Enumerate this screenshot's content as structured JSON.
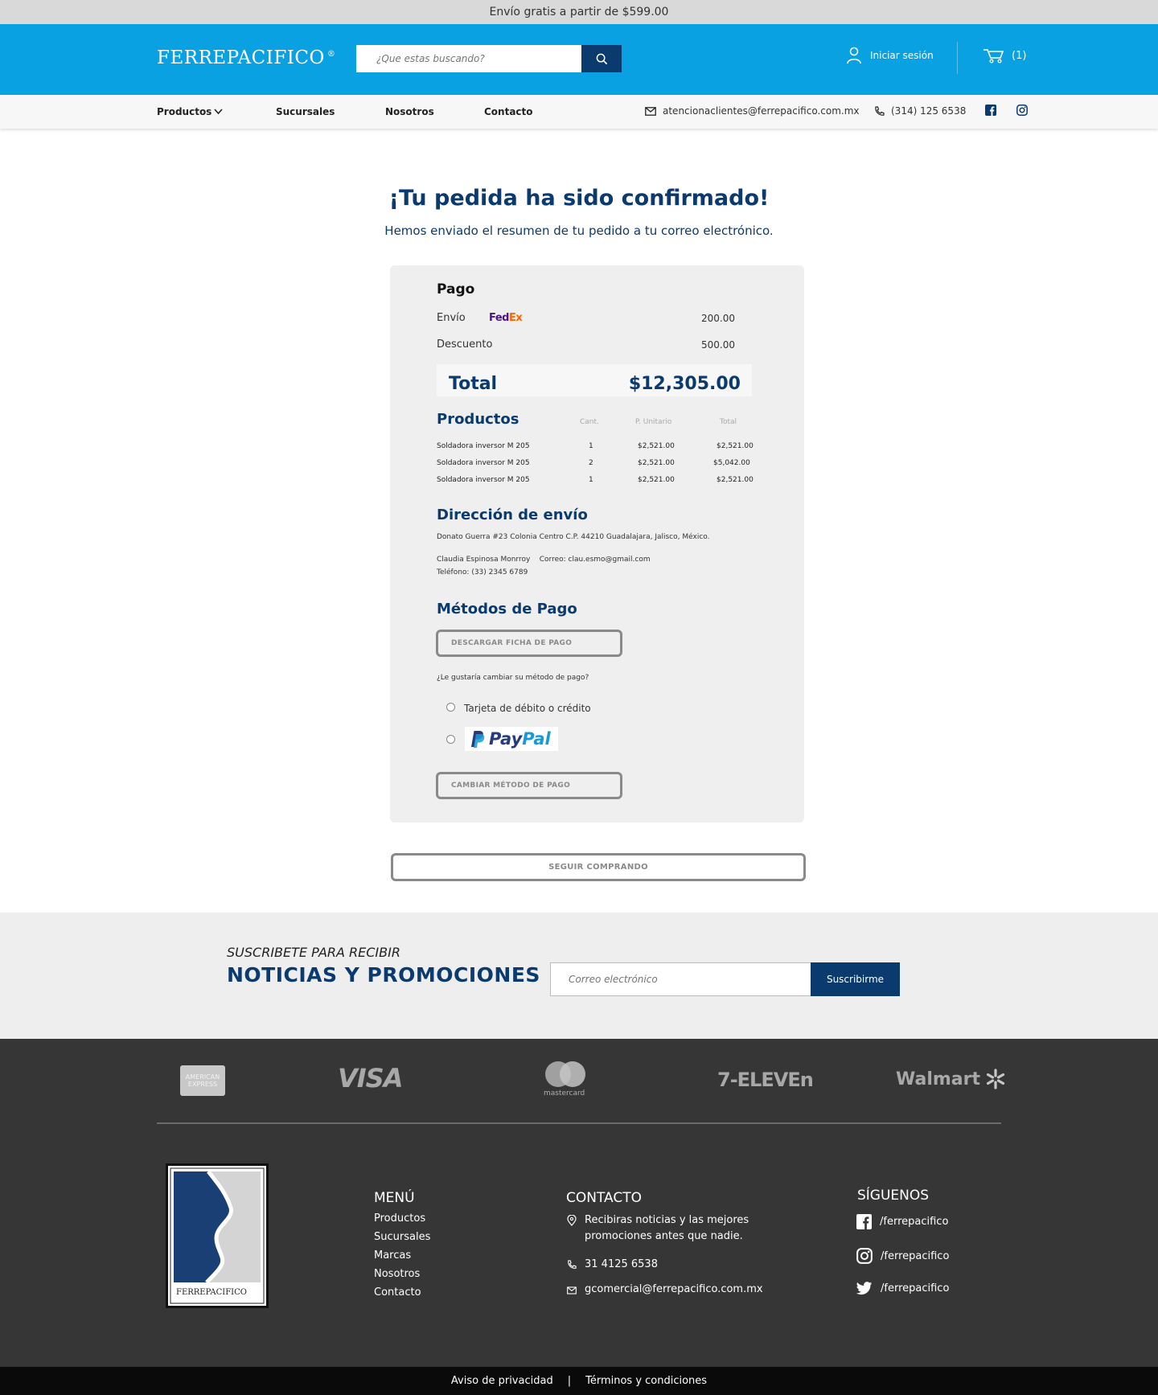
{
  "promo": {
    "text": "Envío gratis a partir de $599.00"
  },
  "header": {
    "logo": "FERREPACIFICO",
    "logo_mark": "®",
    "search_placeholder": "¿Que estas buscando?",
    "login": "Iniciar sesión",
    "cart_count": "(1)"
  },
  "nav": {
    "items": [
      "Productos",
      "Sucursales",
      "Nosotros",
      "Contacto"
    ],
    "email": "atencionaclientes@ferrepacifico.com.mx",
    "phone": "(314) 125 6538"
  },
  "confirmation": {
    "title": "¡Tu pedida ha sido confirmado!",
    "subtitle": "Hemos enviado el resumen de tu pedido a tu correo electrónico."
  },
  "pago": {
    "heading": "Pago",
    "envio_label": "Envío",
    "carrier_a": "Fed",
    "carrier_b": "Ex",
    "envio_value": "200.00",
    "descuento_label": "Descuento",
    "descuento_value": "500.00",
    "total_label": "Total",
    "total_value": "$12,305.00"
  },
  "productos": {
    "heading": "Productos",
    "columns": [
      "Cant.",
      "P. Unitario",
      "Total"
    ],
    "rows": [
      {
        "name": "Soldadora inversor M 205",
        "qty": "1",
        "unit": "$2,521.00",
        "total": "$2,521.00"
      },
      {
        "name": "Soldadora inversor M 205",
        "qty": "2",
        "unit": "$2,521.00",
        "total": "$5,042.00"
      },
      {
        "name": "Soldadora inversor M 205",
        "qty": "1",
        "unit": "$2,521.00",
        "total": "$2,521.00"
      }
    ]
  },
  "direccion": {
    "heading": "Dirección de envío",
    "address": "Donato Guerra #23  Colonia Centro C.P. 44210 Guadalajara, Jalisco, México.",
    "contact": "Claudia Espinosa Monrroy    Correo: clau.esmo@gmail.com",
    "phone": "Teléfono: (33) 2345 6789"
  },
  "metodos": {
    "heading": "Métodos de Pago",
    "download_btn": "DESCARGAR FICHA DE PAGO",
    "question": "¿Le gustaría cambiar su método de pago?",
    "option_card": "Tarjeta de débito o crédito",
    "paypal_a": "Pay",
    "paypal_b": "Pal",
    "change_btn": "CAMBIAR MÉTODO DE PAGO"
  },
  "keep_shopping": "SEGUIR COMPRANDO",
  "newsletter": {
    "line1": "SUSCRIBETE PARA RECIBIR",
    "line2": "NOTICIAS Y PROMOCIONES",
    "placeholder": "Correo electrónico",
    "button": "Suscribirme"
  },
  "footer": {
    "payments": {
      "amex_a": "AMERICAN",
      "amex_b": "EXPRESS",
      "visa": "VISA",
      "mastercard": "mastercard",
      "seven": "7-ELEVEn",
      "walmart": "Walmart"
    },
    "logo_text": "FERREPACIFICO",
    "menu_heading": "MENÚ",
    "menu": [
      "Productos",
      "Sucursales",
      "Marcas",
      "Nosotros",
      "Contacto"
    ],
    "contact_heading": "CONTACTO",
    "contact_text_1": "Recibiras noticias y las mejores",
    "contact_text_2": "promociones antes que nadie.",
    "contact_phone": "31 4125 6538",
    "contact_email": "gcomercial@ferrepacifico.com.mx",
    "social_heading": "SÍGUENOS",
    "social": [
      "/ferrepacifico",
      "/ferrepacifico",
      "/ferrepacifico"
    ]
  },
  "bottom": {
    "privacy": "Aviso de privacidad",
    "sep": "|",
    "terms": "Términos y condiciones"
  },
  "colors": {
    "header_blue": "#0aa1e2",
    "brand_navy": "#0b3a6e",
    "footer_bg": "#363636"
  }
}
